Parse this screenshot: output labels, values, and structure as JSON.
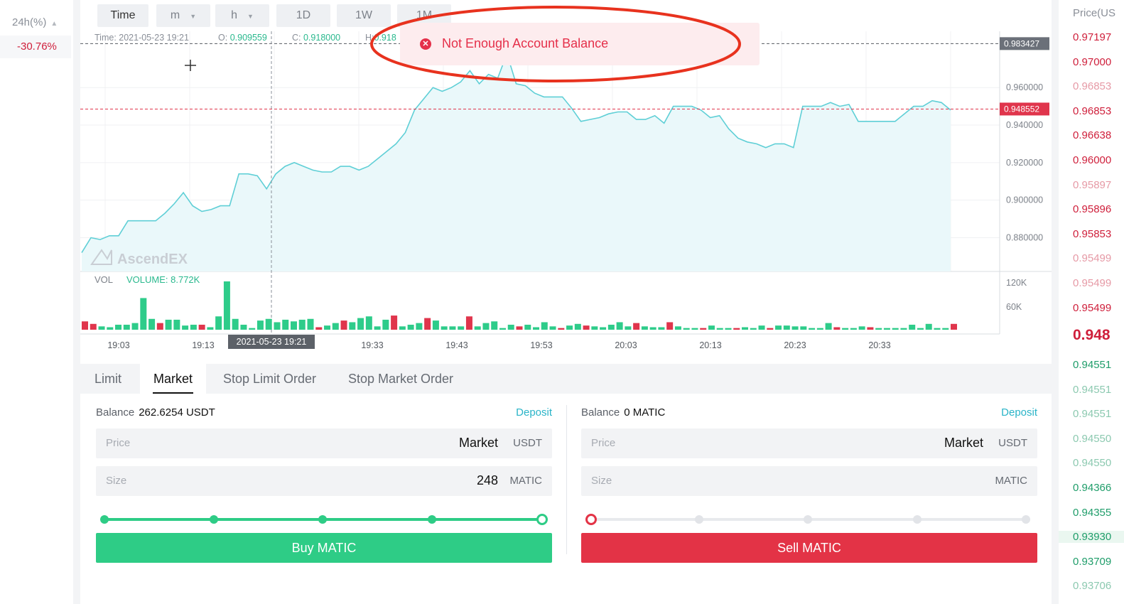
{
  "left_panel": {
    "header": "24h(%)",
    "sort_icon": "sort-icon",
    "change": "-30.76%"
  },
  "timeframes": {
    "time": "Time",
    "m": "m",
    "h": "h",
    "d1": "1D",
    "w1": "1W",
    "m1": "1M"
  },
  "ohlc": {
    "time_label": "Time: 2021-05-23 19:21",
    "o_label": "O:",
    "o_value": "0.909559",
    "c_label": "C:",
    "c_value": "0.918000",
    "h_label": "H:",
    "h_value": "0.918"
  },
  "toast": {
    "message": "Not Enough Account Balance",
    "icon": "error-circle-icon"
  },
  "chart": {
    "price_axis": [
      "0.960000",
      "0.940000",
      "0.920000",
      "0.900000",
      "0.880000"
    ],
    "marker_top": "0.983427",
    "marker_current": "0.948552",
    "watermark": "AscendEX",
    "volume_label": "VOL",
    "volume_value": "VOLUME: 8.772K",
    "volume_axis": [
      "120K",
      "60K"
    ],
    "time_axis": [
      "19:03",
      "19:13",
      "19:33",
      "19:43",
      "19:53",
      "20:03",
      "20:13",
      "20:23",
      "20:33"
    ],
    "crosshair_time": "2021-05-23 19:21",
    "colors": {
      "up": "#2ecc8a",
      "down": "#e0354c",
      "line": "#5fcfd6"
    }
  },
  "chart_data": {
    "type": "line",
    "title": "",
    "xlabel": "",
    "ylabel": "",
    "x_ticks": [
      "19:03",
      "19:13",
      "19:33",
      "19:43",
      "19:53",
      "20:03",
      "20:13",
      "20:23",
      "20:33"
    ],
    "ylim": [
      0.862,
      0.99
    ],
    "series": [
      {
        "values": [
          0.872,
          0.88,
          0.879,
          0.881,
          0.881,
          0.889,
          0.889,
          0.889,
          0.889,
          0.893,
          0.898,
          0.904,
          0.897,
          0.894,
          0.895,
          0.897,
          0.897,
          0.914,
          0.914,
          0.913,
          0.906,
          0.914,
          0.918,
          0.92,
          0.918,
          0.916,
          0.915,
          0.915,
          0.918,
          0.918,
          0.916,
          0.918,
          0.922,
          0.926,
          0.93,
          0.936,
          0.948,
          0.954,
          0.96,
          0.958,
          0.96,
          0.963,
          0.969,
          0.962,
          0.967,
          0.965,
          0.978,
          0.962,
          0.961,
          0.957,
          0.955,
          0.955,
          0.955,
          0.949,
          0.942,
          0.943,
          0.944,
          0.946,
          0.947,
          0.947,
          0.943,
          0.943,
          0.945,
          0.941,
          0.95,
          0.95,
          0.95,
          0.948,
          0.944,
          0.945,
          0.938,
          0.933,
          0.931,
          0.93,
          0.928,
          0.93,
          0.93,
          0.928,
          0.95,
          0.95,
          0.95,
          0.952,
          0.95,
          0.951,
          0.942,
          0.942,
          0.942,
          0.942,
          0.942,
          0.946,
          0.95,
          0.95,
          0.953,
          0.952,
          0.948
        ]
      }
    ],
    "volume": [
      10,
      7,
      4,
      3,
      6,
      6,
      8,
      38,
      13,
      8,
      12,
      12,
      5,
      6,
      6,
      3,
      16,
      58,
      13,
      6,
      2,
      11,
      13,
      9,
      12,
      10,
      12,
      13,
      3,
      5,
      8,
      11,
      9,
      14,
      16,
      4,
      12,
      17,
      4,
      6,
      8,
      14,
      11,
      4,
      4,
      4,
      16,
      4,
      8,
      10,
      2,
      6,
      4,
      6,
      3,
      9,
      4,
      2,
      5,
      7,
      5,
      4,
      3,
      6,
      9,
      4,
      8,
      4,
      3,
      3,
      9,
      4,
      2,
      2,
      2,
      5,
      2,
      2,
      2,
      3,
      2,
      5,
      2,
      5,
      5,
      4,
      4,
      2,
      2,
      8,
      3,
      2,
      2,
      4,
      3,
      2,
      2,
      2,
      2,
      6,
      2,
      7,
      2,
      2,
      7
    ]
  },
  "order_tabs": [
    "Limit",
    "Market",
    "Stop Limit Order",
    "Stop Market Order"
  ],
  "buy": {
    "balance_label": "Balance",
    "balance_value": "262.6254 USDT",
    "deposit": "Deposit",
    "price_placeholder": "Price",
    "price_value": "Market",
    "price_unit": "USDT",
    "size_placeholder": "Size",
    "size_value": "248",
    "size_unit": "MATIC",
    "slider_percent": 100,
    "button": "Buy MATIC"
  },
  "sell": {
    "balance_label": "Balance",
    "balance_value": "0 MATIC",
    "deposit": "Deposit",
    "price_placeholder": "Price",
    "price_value": "Market",
    "price_unit": "USDT",
    "size_placeholder": "Size",
    "size_value": "",
    "size_unit": "MATIC",
    "slider_percent": 0,
    "button": "Sell MATIC"
  },
  "orderbook": {
    "header": "Price(US",
    "asks": [
      "0.97197",
      "0.97000",
      "0.96853",
      "0.96853",
      "0.96638",
      "0.96000",
      "0.95897",
      "0.95896",
      "0.95853",
      "0.95499",
      "0.95499",
      "0.95499"
    ],
    "mid": "0.948",
    "bids": [
      "0.94551",
      "0.94551",
      "0.94551",
      "0.94550",
      "0.94550",
      "0.94366",
      "0.94355",
      "0.93930",
      "0.93709",
      "0.93706"
    ],
    "ask_color": "#cf1f3b",
    "bid_color": "#1f9d6a"
  }
}
